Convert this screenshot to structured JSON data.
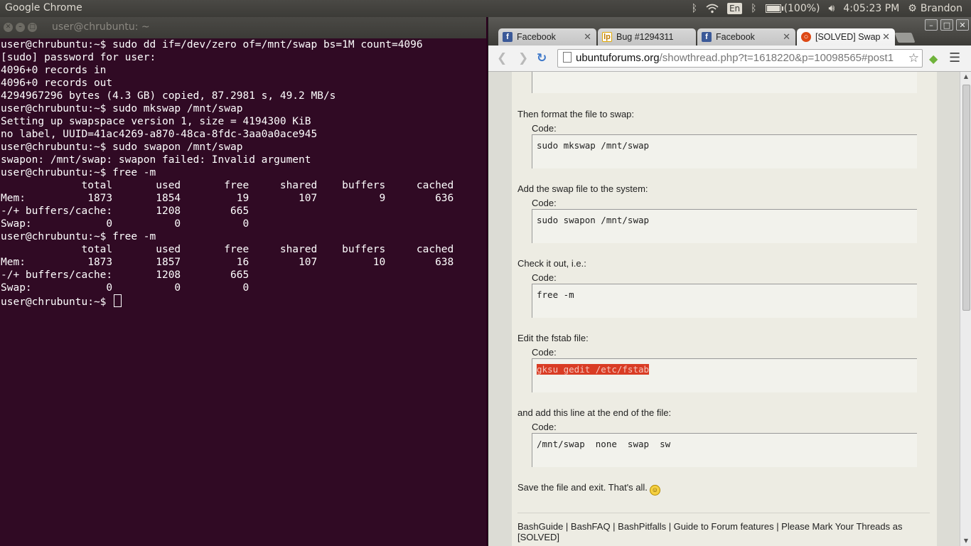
{
  "top_panel": {
    "app_title": "Google Chrome",
    "keyboard_layout": "En",
    "battery": "(100%)",
    "battery_level_percent": 100,
    "clock": "4:05:23 PM",
    "user": "Brandon"
  },
  "terminal": {
    "title": "user@chrubuntu: ~",
    "lines": [
      "user@chrubuntu:~$ sudo dd if=/dev/zero of=/mnt/swap bs=1M count=4096",
      "[sudo] password for user:",
      "4096+0 records in",
      "4096+0 records out",
      "4294967296 bytes (4.3 GB) copied, 87.2981 s, 49.2 MB/s",
      "user@chrubuntu:~$ sudo mkswap /mnt/swap",
      "Setting up swapspace version 1, size = 4194300 KiB",
      "no label, UUID=41ac4269-a870-48ca-8fdc-3aa0a0ace945",
      "user@chrubuntu:~$ sudo swapon /mnt/swap",
      "swapon: /mnt/swap: swapon failed: Invalid argument",
      "user@chrubuntu:~$ free -m",
      "             total       used       free     shared    buffers     cached",
      "Mem:          1873       1854         19        107          9        636",
      "-/+ buffers/cache:       1208        665",
      "Swap:            0          0          0",
      "user@chrubuntu:~$ free -m",
      "             total       used       free     shared    buffers     cached",
      "Mem:          1873       1857         16        107         10        638",
      "-/+ buffers/cache:       1208        665",
      "Swap:            0          0          0"
    ],
    "prompt": "user@chrubuntu:~$ "
  },
  "browser": {
    "tabs": [
      {
        "label": "Facebook",
        "icon": "facebook-icon",
        "active": false
      },
      {
        "label": "Bug #1294311",
        "icon": "launchpad-icon",
        "active": false
      },
      {
        "label": "Facebook",
        "icon": "facebook-icon",
        "active": false
      },
      {
        "label": "[SOLVED] Swap",
        "icon": "ubuntu-icon",
        "active": true
      }
    ],
    "url_host": "ubuntuforums.org",
    "url_path": "/showthread.php?t=1618220&p=10098565#post1",
    "post": {
      "steps": [
        {
          "text": "Then format the file to swap:",
          "code_label": "Code:",
          "code": "sudo mkswap /mnt/swap",
          "selected": false
        },
        {
          "text": "Add the swap file to the system:",
          "code_label": "Code:",
          "code": "sudo swapon /mnt/swap",
          "selected": false
        },
        {
          "text": "Check it out, i.e.:",
          "code_label": "Code:",
          "code": "free -m",
          "selected": false
        },
        {
          "text": "Edit the fstab file:",
          "code_label": "Code:",
          "code": "gksu gedit /etc/fstab",
          "selected": true
        },
        {
          "text": "and add this line at the end of the file:",
          "code_label": "Code:",
          "code": "/mnt/swap  none  swap  sw",
          "selected": false
        }
      ],
      "closing": "Save the file and exit. That's all.",
      "signature": "BashGuide | BashFAQ | BashPitfalls | Guide to Forum features | Please Mark Your Threads as [SOLVED]"
    }
  }
}
